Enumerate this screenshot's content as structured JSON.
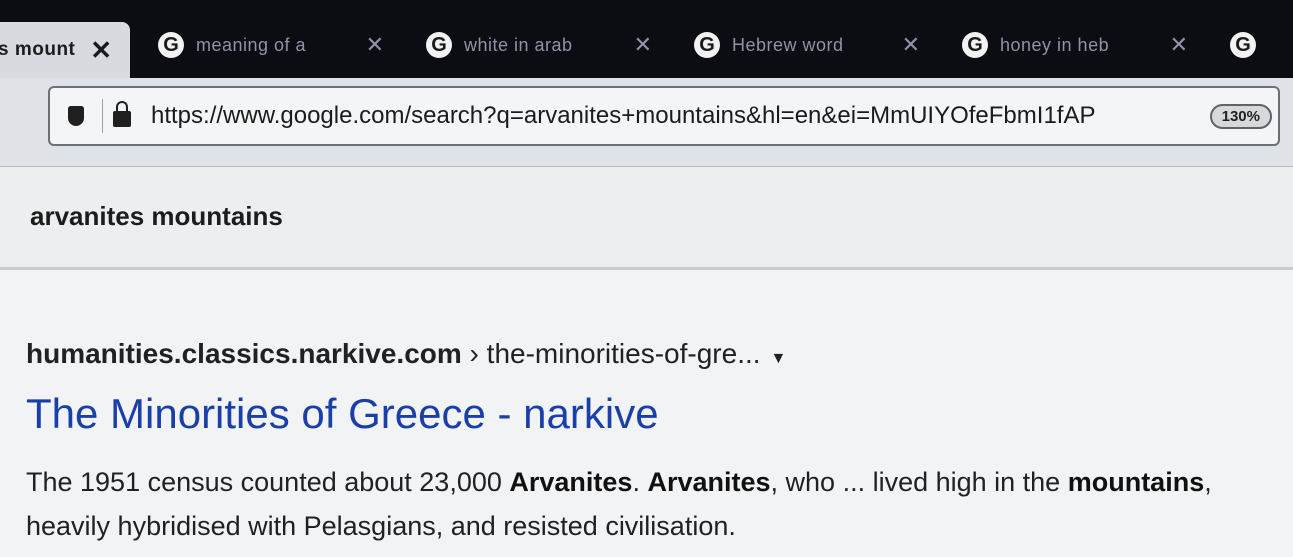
{
  "tabs": [
    {
      "title": "s mount",
      "active": true
    },
    {
      "title": "meaning of a",
      "active": false
    },
    {
      "title": "white in arab",
      "active": false
    },
    {
      "title": "Hebrew word",
      "active": false
    },
    {
      "title": "honey in heb",
      "active": false
    },
    {
      "title": "",
      "active": false
    }
  ],
  "nav": {
    "url": "https://www.google.com/search?q=arvanites+mountains&hl=en&ei=MmUIYOfeFbmI1fAP",
    "zoom": "130%"
  },
  "search": {
    "query": "arvanites mountains"
  },
  "result": {
    "domain": "humanities.classics.narkive.com",
    "path": " › the-minorities-of-gre...",
    "title": "The Minorities of Greece - narkive",
    "snippet_parts": [
      {
        "text": "The 1951 census counted about 23,000 ",
        "bold": false
      },
      {
        "text": "Arvanites",
        "bold": true
      },
      {
        "text": ". ",
        "bold": false
      },
      {
        "text": "Arvanites",
        "bold": true
      },
      {
        "text": ", who ... lived high in the ",
        "bold": false
      },
      {
        "text": "mountains",
        "bold": true
      },
      {
        "text": ", heavily hybridised with Pelasgians, and resisted civilisation.",
        "bold": false
      }
    ]
  }
}
